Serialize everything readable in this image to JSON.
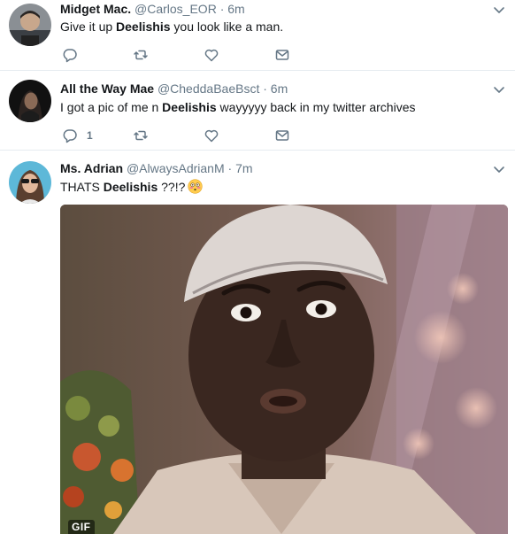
{
  "tweets": [
    {
      "fullname": "Midget Mac.",
      "handle": "@Carlos_EOR",
      "dot": "·",
      "time": "6m",
      "text_before": "Give it up ",
      "mention": "Deelishis",
      "text_after": " you look like a man.",
      "reply_count": ""
    },
    {
      "fullname": "All the Way Mae",
      "handle": "@CheddaBaeBsct",
      "dot": "·",
      "time": "6m",
      "text_before": "I got a pic of me n ",
      "mention": "Deelishis",
      "text_after": " wayyyyy back in my twitter archives",
      "reply_count": "1"
    },
    {
      "fullname": "Ms. Adrian",
      "handle": "@AlwaysAdrianM",
      "dot": "·",
      "time": "7m",
      "text_before": "THATS ",
      "mention": "Deelishis",
      "text_after": " ??!?",
      "emoji": "flushed-face-emoji",
      "media_badge": "GIF"
    }
  ],
  "icons": {
    "reply": "reply-icon",
    "retweet": "retweet-icon",
    "like": "like-icon",
    "dm": "direct-message-icon",
    "caret": "chevron-down-icon"
  },
  "colors": {
    "text_primary": "#14171a",
    "text_secondary": "#657786",
    "divider": "#e6ecf0"
  }
}
